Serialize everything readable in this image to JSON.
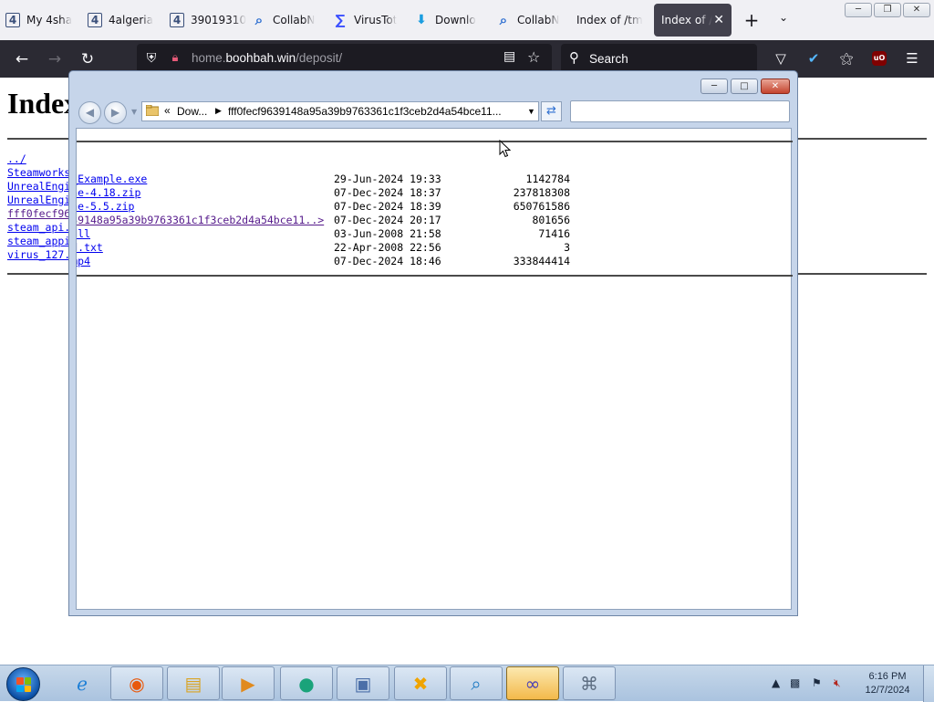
{
  "browser": {
    "tabs": [
      {
        "title": "My 4sha",
        "icon": "four-icon"
      },
      {
        "title": "4algeria",
        "icon": "four-icon"
      },
      {
        "title": "39019310",
        "icon": "four-icon"
      },
      {
        "title": "CollabN",
        "icon": "magnifier-icon"
      },
      {
        "title": "VirusTot",
        "icon": "sigma-icon"
      },
      {
        "title": "Downlo",
        "icon": "download-arrow-icon"
      },
      {
        "title": "CollabN",
        "icon": "magnifier-icon"
      },
      {
        "title": "Index of /tm",
        "icon": ""
      },
      {
        "title": "Index of /",
        "icon": "",
        "active": true
      }
    ],
    "new_tab_symbol": "+",
    "url": {
      "prefix": "home.",
      "domain": "boohbah.win",
      "path": "/deposit/"
    },
    "search_placeholder": "Search"
  },
  "page": {
    "heading": "Index of /deposit/",
    "parent_link": "../",
    "files": [
      {
        "name": "Steamworks_Example.exe",
        "date": "29-Jun-2024 19:33",
        "size": "1142784"
      },
      {
        "name": "UnrealEngine-4.18.zip",
        "date": "07-Dec-2024 18:37",
        "size": "237818308"
      },
      {
        "name": "UnrealEngine-5.5.zip",
        "date": "07-Dec-2024 18:39",
        "size": "650761586"
      },
      {
        "name": "fff0fecf9639148a95a39b9763361c1f3ceb2d4a54bce11..>",
        "date": "07-Dec-2024 20:17",
        "size": "801656",
        "visited": true
      },
      {
        "name": "steam_api.dll",
        "date": "03-Jun-2008 21:58",
        "size": "71416"
      },
      {
        "name": "steam_appid.txt",
        "date": "22-Apr-2008 22:56",
        "size": "3"
      },
      {
        "name": "virus_127.mp4",
        "date": "07-Dec-2024 18:46",
        "size": "333844414"
      }
    ]
  },
  "explorer": {
    "breadcrumb_overflow": "«",
    "breadcrumb_1": "Dow...",
    "breadcrumb_2": "fff0fecf9639148a95a39b9763361c1f3ceb2d4a54bce11...",
    "search_value": ""
  },
  "taskbar": {
    "apps": [
      {
        "name": "internet-explorer",
        "icon": "ie-icon"
      },
      {
        "name": "firefox",
        "icon": "firefox-icon"
      },
      {
        "name": "explorer",
        "icon": "folder-icon"
      },
      {
        "name": "media-player",
        "icon": "media-player-icon"
      },
      {
        "name": "app-green",
        "icon": "green-globe-icon"
      },
      {
        "name": "installer",
        "icon": "installer-icon"
      },
      {
        "name": "app-x",
        "icon": "x-tool-icon"
      },
      {
        "name": "app-search",
        "icon": "search-tool-icon"
      },
      {
        "name": "app-infinity",
        "icon": "infinity-icon",
        "active": true
      },
      {
        "name": "app-network",
        "icon": "network-tool-icon"
      }
    ],
    "time": "6:16 PM",
    "date": "12/7/2024"
  },
  "colors": {
    "link": "#0000ee",
    "visited_link": "#551a8b",
    "browser_chrome_dark": "#2b2a33",
    "taskbar": "#b9cde4"
  }
}
